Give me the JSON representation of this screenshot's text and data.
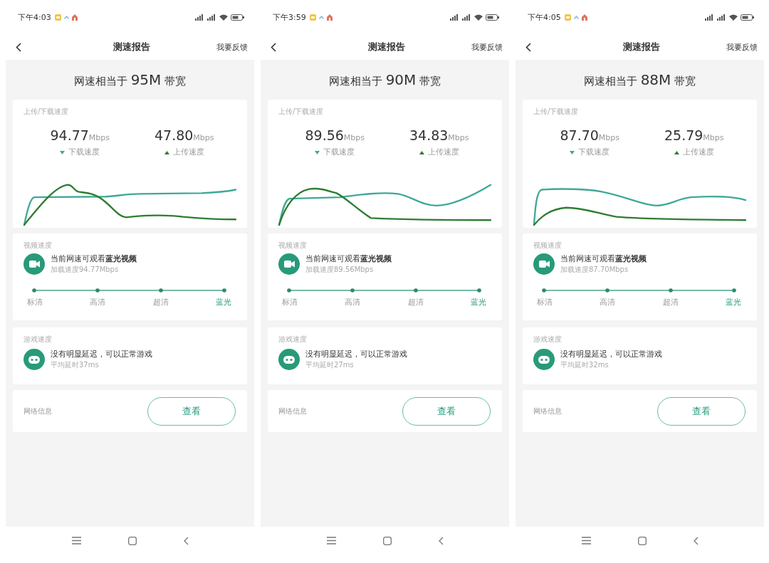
{
  "screens": [
    {
      "status_bar": {
        "time": "下午4:03"
      },
      "header": {
        "title": "测速报告",
        "action": "我要反馈"
      },
      "headline": {
        "prefix": "网速相当于",
        "value": "95M",
        "suffix": "带宽"
      },
      "speed_card": {
        "title": "上传/下载速度",
        "download": {
          "value": "94.77",
          "unit": "Mbps",
          "label": "下载速度",
          "color": "#3fa898"
        },
        "upload": {
          "value": "47.80",
          "unit": "Mbps",
          "label": "上传速度",
          "color": "#2e7d32"
        }
      },
      "video_card": {
        "title": "视频速度",
        "message": "当前网速可观看**蓝光视频**",
        "detail": "加载速度94.77Mbps",
        "levels": [
          {
            "label": "标清",
            "selected": false
          },
          {
            "label": "高清",
            "selected": false
          },
          {
            "label": "超清",
            "selected": false
          },
          {
            "label": "蓝光",
            "selected": true
          }
        ]
      },
      "game_card": {
        "title": "游戏速度",
        "message": "没有明显延迟，可以正常游戏",
        "detail": "平均延时37ms"
      },
      "network_card": {
        "label": "网络信息",
        "button": "查看"
      }
    },
    {
      "status_bar": {
        "time": "下午3:59"
      },
      "header": {
        "title": "测速报告",
        "action": "我要反馈"
      },
      "headline": {
        "prefix": "网速相当于",
        "value": "90M",
        "suffix": "带宽"
      },
      "speed_card": {
        "title": "上传/下载速度",
        "download": {
          "value": "89.56",
          "unit": "Mbps",
          "label": "下载速度",
          "color": "#3fa898"
        },
        "upload": {
          "value": "34.83",
          "unit": "Mbps",
          "label": "上传速度",
          "color": "#2e7d32"
        }
      },
      "video_card": {
        "title": "视频速度",
        "message": "当前网速可观看**蓝光视频**",
        "detail": "加载速度89.56Mbps",
        "levels": [
          {
            "label": "标清",
            "selected": false
          },
          {
            "label": "高清",
            "selected": false
          },
          {
            "label": "超清",
            "selected": false
          },
          {
            "label": "蓝光",
            "selected": true
          }
        ]
      },
      "game_card": {
        "title": "游戏速度",
        "message": "没有明显延迟，可以正常游戏",
        "detail": "平均延时27ms"
      },
      "network_card": {
        "label": "网络信息",
        "button": "查看"
      }
    },
    {
      "status_bar": {
        "time": "下午4:05"
      },
      "header": {
        "title": "测速报告",
        "action": "我要反馈"
      },
      "headline": {
        "prefix": "网速相当于",
        "value": "88M",
        "suffix": "带宽"
      },
      "speed_card": {
        "title": "上传/下载速度",
        "download": {
          "value": "87.70",
          "unit": "Mbps",
          "label": "下载速度",
          "color": "#3fa898"
        },
        "upload": {
          "value": "25.79",
          "unit": "Mbps",
          "label": "上传速度",
          "color": "#2e7d32"
        }
      },
      "video_card": {
        "title": "视频速度",
        "message": "当前网速可观看**蓝光视频**",
        "detail": "加载速度87.70Mbps",
        "levels": [
          {
            "label": "标清",
            "selected": false
          },
          {
            "label": "高清",
            "selected": false
          },
          {
            "label": "超清",
            "selected": false
          },
          {
            "label": "蓝光",
            "selected": true
          }
        ]
      },
      "game_card": {
        "title": "游戏速度",
        "message": "没有明显延迟，可以正常游戏",
        "detail": "平均延时32ms"
      },
      "network_card": {
        "label": "网络信息",
        "button": "查看"
      }
    }
  ]
}
